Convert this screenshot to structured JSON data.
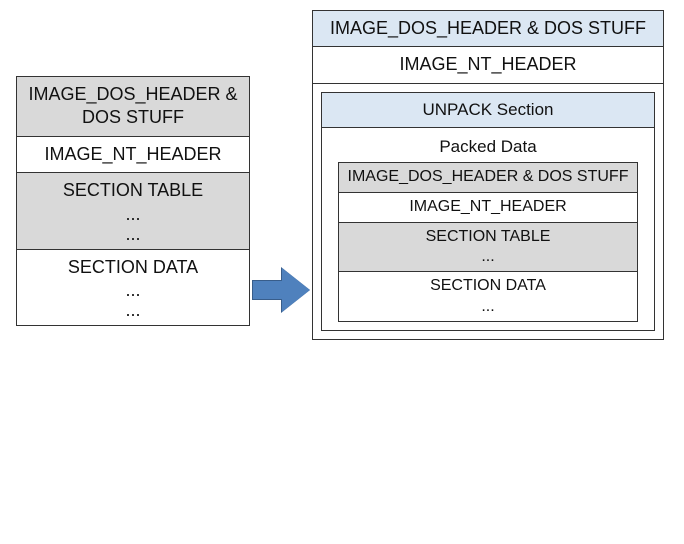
{
  "left": {
    "dos": "IMAGE_DOS_HEADER & DOS STUFF",
    "nt": "IMAGE_NT_HEADER",
    "sectable": "SECTION TABLE",
    "dots1a": "...",
    "dots1b": "...",
    "secdata": "SECTION DATA",
    "dots2a": "...",
    "dots2b": "..."
  },
  "right": {
    "dos": "IMAGE_DOS_HEADER & DOS STUFF",
    "nt": "IMAGE_NT_HEADER",
    "unpack_title": "UNPACK Section",
    "packed_label": "Packed Data",
    "packed": {
      "dos": "IMAGE_DOS_HEADER & DOS STUFF",
      "nt": "IMAGE_NT_HEADER",
      "sectable": "SECTION TABLE",
      "dots1": "...",
      "secdata": "SECTION DATA",
      "dots2": "..."
    }
  }
}
